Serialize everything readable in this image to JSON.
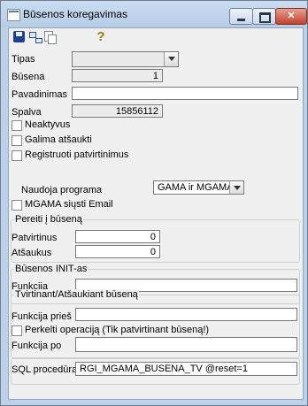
{
  "window": {
    "title": "Būsenos koregavimas",
    "close_label": "✕"
  },
  "toolbar": {
    "save_icon": "save-icon",
    "tree_icon": "tree-icon",
    "copy_icon": "copy-icon",
    "help_label": "?"
  },
  "form": {
    "tipas": {
      "label": "Tipas",
      "value": ""
    },
    "busena": {
      "label": "Būsena",
      "value": "1"
    },
    "pavadinimas": {
      "label": "Pavadinimas",
      "value": ""
    },
    "spalva": {
      "label": "Spalva",
      "value": "15856112"
    },
    "checkboxes": [
      {
        "label": "Neaktyvus",
        "checked": false
      },
      {
        "label": "Galima atšaukti",
        "checked": false
      },
      {
        "label": "Registruoti patvirtinimus",
        "checked": false
      }
    ],
    "naudoja_programa": {
      "label": "Naudoja programa",
      "selected": "GAMA ir MGAMA"
    },
    "mgama_email": {
      "label": "MGAMA siųsti Email",
      "checked": false
    },
    "pereiti": {
      "title": "Pereiti į būseną",
      "patvirtinus": {
        "label": "Patvirtinus",
        "value": "0"
      },
      "atsaukus": {
        "label": "Atšaukus",
        "value": "0"
      }
    },
    "init": {
      "title": "Būsenos INIT-as",
      "funkcija": {
        "label": "Funkcija",
        "value": ""
      }
    },
    "tvirtinant": {
      "title": "Tvirtinant/Atšaukiant būseną",
      "funkcija_pries": {
        "label": "Funkcija prieš",
        "value": ""
      },
      "perkelti": {
        "label": "Perkelti operaciją (Tik patvirtinant būseną!)",
        "checked": false
      },
      "funkcija_po": {
        "label": "Funkcija po",
        "value": ""
      }
    },
    "sql": {
      "label": "SQL procedūra",
      "value": "RGI_MGAMA_BUSENA_TV @reset=1"
    }
  }
}
